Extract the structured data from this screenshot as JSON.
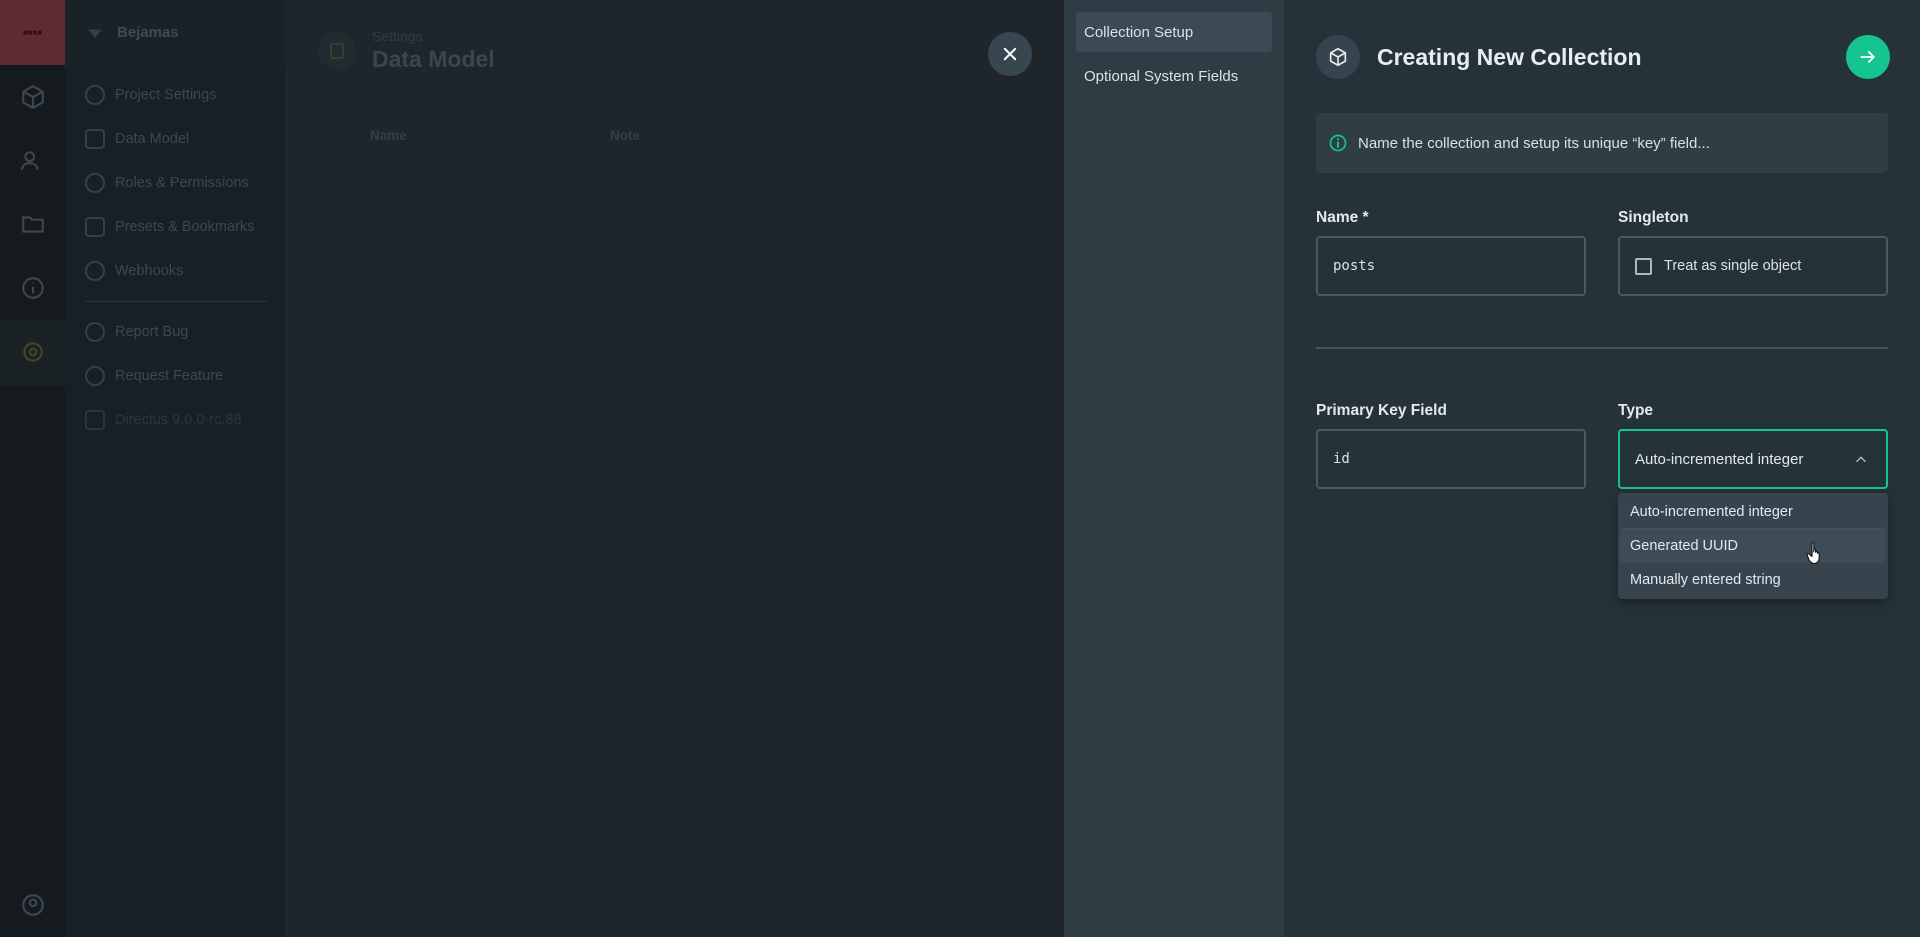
{
  "background": {
    "project_name": "Bejamas",
    "header": {
      "breadcrumb": "Settings",
      "title": "Data Model"
    },
    "nav_items": [
      {
        "label": "Project Settings",
        "icon": "globe-icon"
      },
      {
        "label": "Data Model",
        "icon": "list-icon"
      },
      {
        "label": "Roles & Permissions",
        "icon": "roles-icon"
      },
      {
        "label": "Presets & Bookmarks",
        "icon": "bookmark-icon"
      },
      {
        "label": "Webhooks",
        "icon": "anchor-icon"
      }
    ],
    "nav_items_secondary": [
      {
        "label": "Report Bug",
        "icon": "bug-icon"
      },
      {
        "label": "Request Feature",
        "icon": "alert-icon"
      },
      {
        "label": "Directus 9.0.0-rc.88",
        "icon": "directus-icon"
      }
    ],
    "table_columns": [
      "Name",
      "Note"
    ]
  },
  "drawer": {
    "nav": [
      "Collection Setup",
      "Optional System Fields"
    ],
    "title": "Creating New Collection",
    "notice": "Name the collection and setup its unique “key” field...",
    "name_label": "Name *",
    "name_value": "posts",
    "singleton_label": "Singleton",
    "singleton_option": "Treat as single object",
    "singleton_checked": false,
    "pk_label": "Primary Key Field",
    "pk_value": "id",
    "type_label": "Type",
    "type_value": "Auto-incremented integer",
    "type_options": [
      "Auto-incremented integer",
      "Generated UUID",
      "Manually entered string"
    ],
    "hovered_option": "Generated UUID"
  },
  "colors": {
    "accent": "#16c48f",
    "drawer_bg": "#26323a"
  }
}
